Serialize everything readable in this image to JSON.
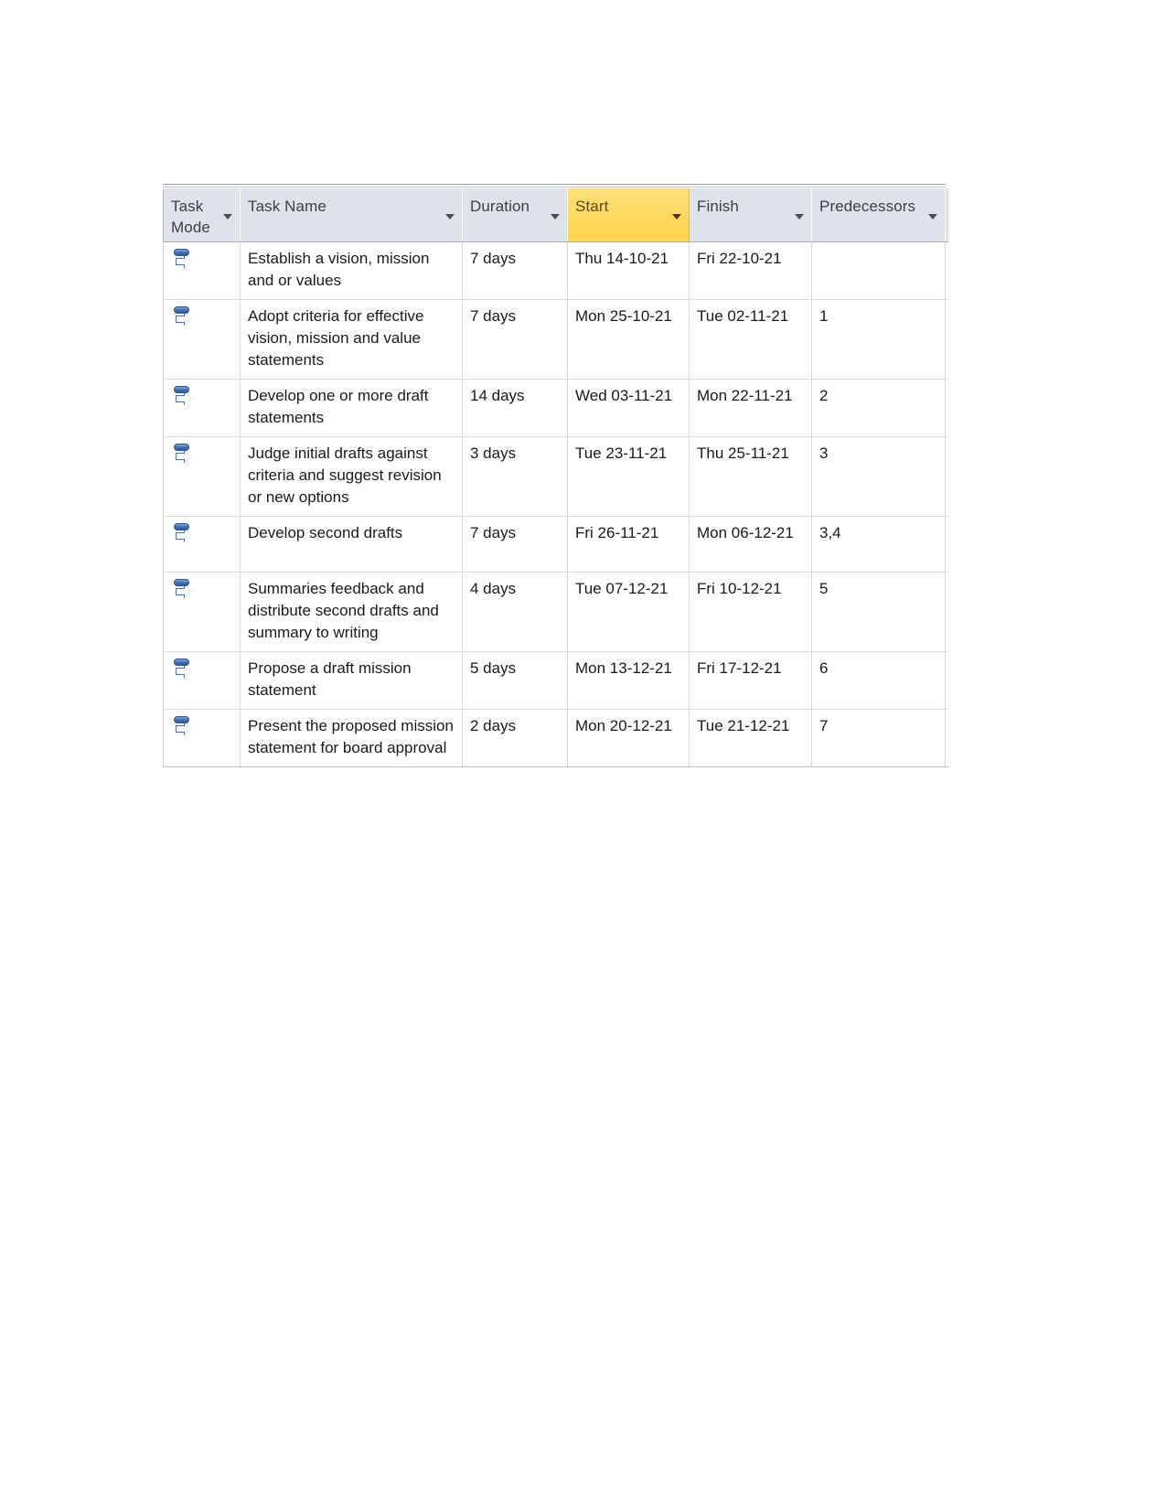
{
  "grid": {
    "columns": [
      {
        "key": "task_mode",
        "label": "Task Mode",
        "filter_icon": "chevron-down-icon",
        "highlighted": false
      },
      {
        "key": "task_name",
        "label": "Task Name",
        "filter_icon": "chevron-down-icon",
        "highlighted": false
      },
      {
        "key": "duration",
        "label": "Duration",
        "filter_icon": "chevron-down-icon",
        "highlighted": false
      },
      {
        "key": "start",
        "label": "Start",
        "filter_icon": "chevron-down-icon",
        "highlighted": true
      },
      {
        "key": "finish",
        "label": "Finish",
        "filter_icon": "chevron-down-icon",
        "highlighted": false
      },
      {
        "key": "predecessors",
        "label": "Predecessors",
        "filter_icon": "chevron-down-icon",
        "highlighted": false
      }
    ],
    "highlight_color": "#ffd966",
    "header_bg_color": "#dfe2e8",
    "rows": [
      {
        "task_mode_icon": "auto-scheduled-icon",
        "task_name": "Establish a vision, mission and or values",
        "duration": "7 days",
        "start": "Thu 14-10-21",
        "finish": "Fri 22-10-21",
        "predecessors": ""
      },
      {
        "task_mode_icon": "auto-scheduled-icon",
        "task_name": "Adopt criteria for effective vision, mission and value statements",
        "duration": "7 days",
        "start": "Mon 25-10-21",
        "finish": "Tue 02-11-21",
        "predecessors": "1"
      },
      {
        "task_mode_icon": "auto-scheduled-icon",
        "task_name": "Develop one or more draft statements",
        "duration": "14 days",
        "start": "Wed 03-11-21",
        "finish": "Mon 22-11-21",
        "predecessors": "2"
      },
      {
        "task_mode_icon": "auto-scheduled-icon",
        "task_name": "Judge initial drafts against criteria and suggest revision or new options",
        "duration": "3 days",
        "start": "Tue 23-11-21",
        "finish": "Thu 25-11-21",
        "predecessors": "3"
      },
      {
        "task_mode_icon": "auto-scheduled-icon",
        "task_name": "Develop second drafts",
        "duration": "7 days",
        "start": "Fri 26-11-21",
        "finish": "Mon 06-12-21",
        "predecessors": "3,4"
      },
      {
        "task_mode_icon": "auto-scheduled-icon",
        "task_name": "Summaries feedback and distribute second drafts and summary to writing",
        "duration": "4 days",
        "start": "Tue 07-12-21",
        "finish": "Fri 10-12-21",
        "predecessors": "5"
      },
      {
        "task_mode_icon": "auto-scheduled-icon",
        "task_name": "Propose a draft mission statement",
        "duration": "5 days",
        "start": "Mon 13-12-21",
        "finish": "Fri 17-12-21",
        "predecessors": "6"
      },
      {
        "task_mode_icon": "auto-scheduled-icon",
        "task_name": "Present the proposed mission statement for board approval",
        "duration": "2 days",
        "start": "Mon 20-12-21",
        "finish": "Tue 21-12-21",
        "predecessors": "7"
      }
    ]
  }
}
